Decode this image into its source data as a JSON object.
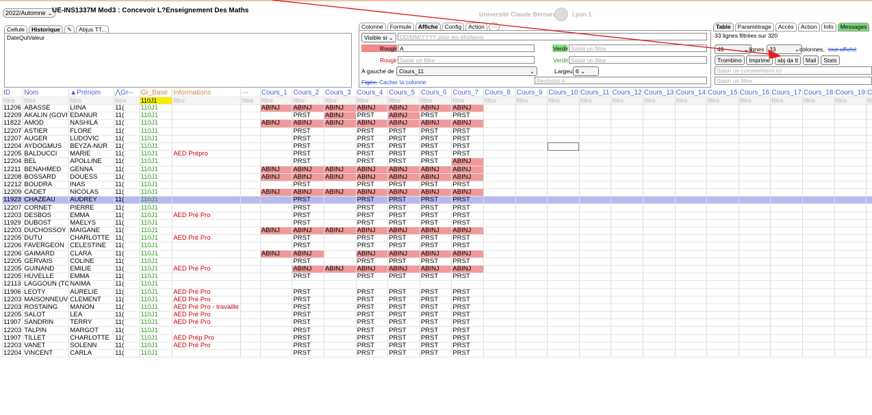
{
  "header": {
    "semester": "2022/Automne",
    "course_title": "UE-INS1337M Mod3 : Concevoir L?Enseignement Des Maths",
    "university_left": "Université Claude Bernard",
    "university_right": "Lyon 1"
  },
  "left_panel": {
    "tabs": [
      "Cellule",
      "Historique",
      "✎",
      "Abjus TT..."
    ],
    "columns": "DateQuiValeur"
  },
  "column_panel": {
    "tabs": [
      "Colonne",
      "Formule",
      "Affiche",
      "Config",
      "Action"
    ],
    "visible_si": "Visible si",
    "date_placeholder": "DD/MM/YYYY pour les étudiants",
    "rougir1_label": "Rougir",
    "rougir1_value": "A",
    "verdir1_label": "Verdir",
    "verdir1_placeholder": "Saisir un filtre",
    "rougir2_label": "Rougir",
    "rougir2_placeholder": "Saisir un filtre",
    "verdir2_label": "Verdir",
    "verdir2_placeholder": "Saisir un filtre",
    "gauche_label": "À gauche de",
    "gauche_value": "Cours_11",
    "largeur_label": "Largeur",
    "largeur_value": "6",
    "figee": "Figée.",
    "cacher": "Cacher la colonne",
    "restreint_placeholder": "Restreint à"
  },
  "table_panel": {
    "tabs": [
      "Table",
      "Paramétrage",
      "Accès",
      "Action",
      "Info",
      "Messages"
    ],
    "filtered": "33 lignes filtrées sur 320",
    "lignes_value": "49",
    "lignes_label": "lignes",
    "colonnes_value": "33",
    "colonnes_label": "colonnes,",
    "tout_affiche": "tout affiché",
    "buttons": [
      "Trombino",
      "Imprime",
      "abj da tt",
      "Mail",
      "Stats"
    ],
    "comment_placeholder": "Saisir un commentaire ici",
    "filter_placeholder": "Saisir un filtre"
  },
  "grid": {
    "headers": [
      "ID",
      "Nom",
      "▲Prénom",
      "⋀Gr--",
      "Gr_Base",
      "Informations",
      "---",
      "Cours_1",
      "Cours_2",
      "Cours_3",
      "Cours_4",
      "Cours_5",
      "Cours_6",
      "Cours_7",
      "Cours_8",
      "Cours_9",
      "Cours_10",
      "Cours_11",
      "Cours_12",
      "Cours_13",
      "Cours_14",
      "Cours_15",
      "Cours_16",
      "Cours_17",
      "Cours_18",
      "Cours_19",
      "Co"
    ],
    "filter_word": "filtre",
    "gr_base_filter": "110J1",
    "rows": [
      {
        "id": "11206",
        "nom": "ABASSE",
        "prenom": "LIINA",
        "gr": "11(",
        "base": "110J1",
        "info": "",
        "c": [
          "ABINJ",
          "ABINJ",
          "ABINJ",
          "ABINJ",
          "ABINJ",
          "ABINJ",
          "ABINJ"
        ]
      },
      {
        "id": "12209",
        "nom": "AKALIN (GOVI",
        "prenom": "EDANUR",
        "gr": "11(",
        "base": "110J1",
        "info": "",
        "c": [
          "",
          "PRST",
          "ABINJ",
          "PRST",
          "ABINJ",
          "PRST",
          "PRST"
        ]
      },
      {
        "id": "11822",
        "nom": "AMOD",
        "prenom": "NASHILA",
        "gr": "11(",
        "base": "110J1",
        "info": "",
        "c": [
          "ABINJ",
          "ABINJ",
          "ABINJ",
          "ABINJ",
          "ABINJ",
          "ABINJ",
          "ABINJ"
        ]
      },
      {
        "id": "12207",
        "nom": "ASTIER",
        "prenom": "FLORE",
        "gr": "11(",
        "base": "110J1",
        "info": "",
        "c": [
          "",
          "PRST",
          "",
          "PRST",
          "PRST",
          "PRST",
          "PRST"
        ]
      },
      {
        "id": "12207",
        "nom": "AUGER",
        "prenom": "LUDOVIC",
        "gr": "11(",
        "base": "110J1",
        "info": "",
        "c": [
          "",
          "PRST",
          "",
          "PRST",
          "PRST",
          "PRST",
          "PRST"
        ]
      },
      {
        "id": "12204",
        "nom": "AYDOGMUS",
        "prenom": "BEYZA-NUR",
        "gr": "11(",
        "base": "110J1",
        "info": "",
        "c": [
          "",
          "PRST",
          "",
          "PRST",
          "PRST",
          "PRST",
          "PRST"
        ]
      },
      {
        "id": "12205",
        "nom": "BALDUCCI",
        "prenom": "MARIE",
        "gr": "11(",
        "base": "110J1",
        "info": "AED Prépro",
        "c": [
          "",
          "PRST",
          "",
          "PRST",
          "PRST",
          "PRST",
          "PRST"
        ]
      },
      {
        "id": "12204",
        "nom": "BEL",
        "prenom": "APOLLINE",
        "gr": "11(",
        "base": "110J1",
        "info": "",
        "c": [
          "",
          "PRST",
          "",
          "PRST",
          "PRST",
          "PRST",
          "ABINJ"
        ]
      },
      {
        "id": "12211",
        "nom": "BENAHMED",
        "prenom": "GENNA",
        "gr": "11(",
        "base": "110J1",
        "info": "",
        "c": [
          "ABINJ",
          "ABINJ",
          "ABINJ",
          "ABINJ",
          "ABINJ",
          "ABINJ",
          "ABINJ"
        ]
      },
      {
        "id": "12208",
        "nom": "BOSSARD",
        "prenom": "DOUESS",
        "gr": "11(",
        "base": "110J1",
        "info": "",
        "c": [
          "ABINJ",
          "ABINJ",
          "ABINJ",
          "ABINJ",
          "ABINJ",
          "ABINJ",
          "ABINJ"
        ]
      },
      {
        "id": "12212",
        "nom": "BOUDRA",
        "prenom": "INAS",
        "gr": "11(",
        "base": "110J1",
        "info": "",
        "c": [
          "",
          "PRST",
          "",
          "PRST",
          "PRST",
          "PRST",
          "PRST"
        ]
      },
      {
        "id": "12209",
        "nom": "CADET",
        "prenom": "NICOLAS",
        "gr": "11(",
        "base": "110J1",
        "info": "",
        "c": [
          "ABINJ",
          "ABINJ",
          "ABINJ",
          "ABINJ",
          "ABINJ",
          "ABINJ",
          "ABINJ"
        ]
      },
      {
        "id": "11923",
        "nom": "CHAZEAU",
        "prenom": "AUDREY",
        "gr": "11(",
        "base": "110J1",
        "info": "",
        "c": [
          "",
          "PRST",
          "",
          "PRST",
          "PRST",
          "PRST",
          "PRST"
        ]
      },
      {
        "id": "12207",
        "nom": "CORNET",
        "prenom": "PIERRE",
        "gr": "11(",
        "base": "110J1",
        "info": "",
        "c": [
          "",
          "PRST",
          "",
          "PRST",
          "PRST",
          "PRST",
          "PRST"
        ]
      },
      {
        "id": "12203",
        "nom": "DESBOS",
        "prenom": "EMMA",
        "gr": "11(",
        "base": "110J1",
        "info": "AED Pré Pro",
        "c": [
          "",
          "PRST",
          "",
          "PRST",
          "PRST",
          "PRST",
          "PRST"
        ]
      },
      {
        "id": "11929",
        "nom": "DUBOST",
        "prenom": "MAELYS",
        "gr": "11(",
        "base": "110J1",
        "info": "",
        "c": [
          "",
          "PRST",
          "",
          "PRST",
          "PRST",
          "PRST",
          "PRST"
        ]
      },
      {
        "id": "12203",
        "nom": "DUCHOSSOY",
        "prenom": "MAIGANE",
        "gr": "11(",
        "base": "110J1",
        "info": "",
        "c": [
          "ABINJ",
          "ABINJ",
          "ABINJ",
          "ABINJ",
          "ABINJ",
          "ABINJ",
          "ABINJ"
        ]
      },
      {
        "id": "12205",
        "nom": "DUTU",
        "prenom": "CHARLOTTE",
        "gr": "11(",
        "base": "110J1",
        "info": "AED Pré Pro",
        "c": [
          "",
          "PRST",
          "",
          "PRST",
          "PRST",
          "PRST",
          "PRST"
        ]
      },
      {
        "id": "12206",
        "nom": "FAVERGEON",
        "prenom": "CELESTINE",
        "gr": "11(",
        "base": "110J1",
        "info": "",
        "c": [
          "",
          "PRST",
          "",
          "PRST",
          "PRST",
          "PRST",
          "PRST"
        ]
      },
      {
        "id": "12206",
        "nom": "GAIMARD",
        "prenom": "CLARA",
        "gr": "11(",
        "base": "110J1",
        "info": "",
        "c": [
          "ABINJ",
          "ABINJ",
          "",
          "ABINJ",
          "ABINJ",
          "ABINJ",
          "ABINJ"
        ]
      },
      {
        "id": "12205",
        "nom": "GERVAIS",
        "prenom": "COLINE",
        "gr": "11(",
        "base": "110J1",
        "info": "",
        "c": [
          "",
          "PRST",
          "",
          "PRST",
          "PRST",
          "PRST",
          "PRST"
        ]
      },
      {
        "id": "12205",
        "nom": "GUINAND",
        "prenom": "EMILIE",
        "gr": "11(",
        "base": "110J1",
        "info": "AED Pré Pro",
        "c": [
          "",
          "ABINJ",
          "ABINJ",
          "ABINJ",
          "ABINJ",
          "ABINJ",
          "ABINJ"
        ]
      },
      {
        "id": "12205",
        "nom": "HUVELLE",
        "prenom": "EMMA",
        "gr": "11(",
        "base": "110J1",
        "info": "",
        "c": [
          "",
          "PRST",
          "",
          "PRST",
          "PRST",
          "PRST",
          "PRST"
        ]
      },
      {
        "id": "12113",
        "nom": "LAGGOUN (TC",
        "prenom": "NAIMA",
        "gr": "11(",
        "base": "110J1",
        "info": "",
        "c": [
          "",
          "",
          "",
          "",
          "",
          "",
          ""
        ]
      },
      {
        "id": "11906",
        "nom": "LEOTY",
        "prenom": "AURELIE",
        "gr": "11(",
        "base": "110J1",
        "info": "AED Pré Pro",
        "c": [
          "",
          "PRST",
          "",
          "PRST",
          "PRST",
          "PRST",
          "PRST"
        ]
      },
      {
        "id": "12203",
        "nom": "MAISONNEUV",
        "prenom": "CLEMENT",
        "gr": "11(",
        "base": "110J1",
        "info": "AED Pré Pro",
        "c": [
          "",
          "PRST",
          "",
          "PRST",
          "PRST",
          "PRST",
          "PRST"
        ]
      },
      {
        "id": "12203",
        "nom": "ROSTAING",
        "prenom": "MANON",
        "gr": "11(",
        "base": "110J1",
        "info": "AED Pré Pro - travaille",
        "c": [
          "",
          "PRST",
          "",
          "PRST",
          "PRST",
          "PRST",
          "PRST"
        ]
      },
      {
        "id": "12205",
        "nom": "SALOT",
        "prenom": "LEA",
        "gr": "11(",
        "base": "110J1",
        "info": "AED Pré Pro",
        "c": [
          "",
          "PRST",
          "",
          "PRST",
          "PRST",
          "PRST",
          "PRST"
        ]
      },
      {
        "id": "11907",
        "nom": "SANDRIN",
        "prenom": "TERRY",
        "gr": "11(",
        "base": "110J1",
        "info": "AED Pré Pro",
        "c": [
          "",
          "PRST",
          "",
          "PRST",
          "PRST",
          "PRST",
          "PRST"
        ]
      },
      {
        "id": "12203",
        "nom": "TALPIN",
        "prenom": "MARGOT",
        "gr": "11(",
        "base": "110J1",
        "info": "",
        "c": [
          "",
          "PRST",
          "",
          "PRST",
          "PRST",
          "PRST",
          "PRST"
        ]
      },
      {
        "id": "11907",
        "nom": "TILLET",
        "prenom": "CHARLOTTE",
        "gr": "11(",
        "base": "110J1",
        "info": "AED Prép Pro",
        "c": [
          "",
          "PRST",
          "",
          "PRST",
          "PRST",
          "PRST",
          "PRST"
        ]
      },
      {
        "id": "12203",
        "nom": "VANET",
        "prenom": "SOLENN",
        "gr": "11(",
        "base": "110J1",
        "info": "AED Pré Pro",
        "c": [
          "",
          "PRST",
          "",
          "PRST",
          "PRST",
          "PRST",
          "PRST"
        ]
      },
      {
        "id": "12204",
        "nom": "VINCENT",
        "prenom": "CARLA",
        "gr": "11(",
        "base": "110J1",
        "info": "",
        "c": [
          "",
          "PRST",
          "",
          "PRST",
          "PRST",
          "PRST",
          "PRST"
        ]
      }
    ],
    "selected_row_index": 12
  },
  "colors": {
    "absent": "#f09a9a",
    "selected": "#b8b8f0",
    "group": "#2b9a1a",
    "info": "#cc0000",
    "header": "#4a5bd6",
    "annotation_arrow": "#e02020"
  }
}
